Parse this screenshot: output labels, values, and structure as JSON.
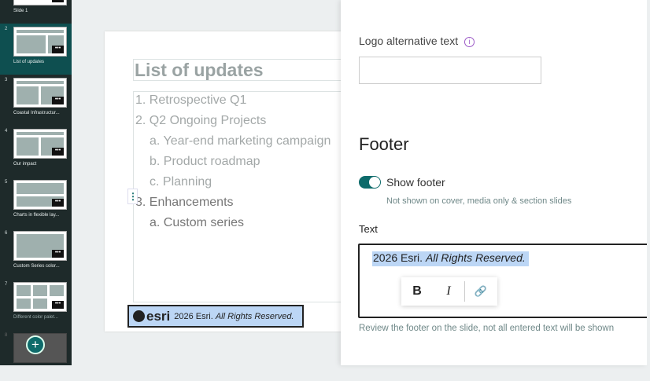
{
  "sidebar": {
    "slides": [
      {
        "num": "",
        "label": "Slide 1"
      },
      {
        "num": "2",
        "label": "List of updates"
      },
      {
        "num": "3",
        "label": "Coastal Infrastructur..."
      },
      {
        "num": "4",
        "label": "Our impact"
      },
      {
        "num": "5",
        "label": "Charts in flexible lay..."
      },
      {
        "num": "6",
        "label": "Custom Series color..."
      },
      {
        "num": "7",
        "label": "Different color palet..."
      },
      {
        "num": "8",
        "label": ""
      }
    ],
    "more": "•••",
    "add": "+"
  },
  "slide": {
    "title": "List of updates",
    "items": [
      "1. Retrospective Q1",
      "2. Q2 Ongoing Projects",
      "a. Year-end marketing campaign",
      "b. Product roadmap",
      "c. Planning",
      "3. Enhancements",
      "a. Custom series"
    ],
    "handle": "⋮",
    "logo": "esri",
    "footer_plain": "2026 Esri.",
    "footer_italic": "All Rights Reserved."
  },
  "panel": {
    "logo_alt_label": "Logo alternative text",
    "info": "i",
    "logo_alt_value": "",
    "footer_heading": "Footer",
    "show_footer": "Show footer",
    "show_footer_on": true,
    "show_footer_hint": "Not shown on cover, media only & section slides",
    "text_label": "Text",
    "text_plain": "2026 Esri.",
    "text_italic": "All Rights Reserved.",
    "bold": "B",
    "italic": "I",
    "link": "🔗",
    "hint": "Review the footer on the slide, not all entered text will be shown"
  }
}
